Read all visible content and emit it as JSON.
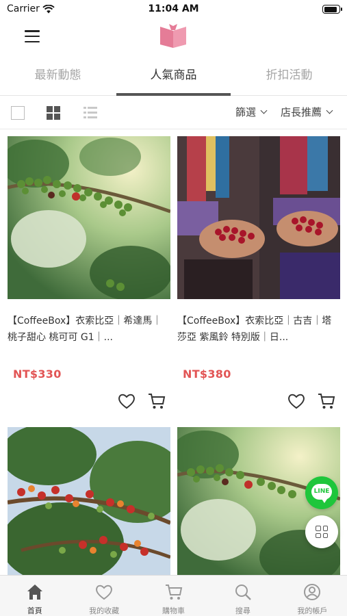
{
  "status_bar": {
    "carrier": "Carrier",
    "time": "11:04 AM"
  },
  "header": {
    "menu_icon": "hamburger-icon",
    "logo_icon": "open-book-logo"
  },
  "tabs": [
    {
      "label": "最新動態",
      "active": false
    },
    {
      "label": "人氣商品",
      "active": true
    },
    {
      "label": "折扣活動",
      "active": false
    }
  ],
  "toolbar": {
    "view_modes": [
      "single-view-icon",
      "grid-view-icon",
      "list-view-icon"
    ],
    "active_view": "grid",
    "filter_label": "篩選",
    "sort_label": "店長推薦"
  },
  "products": [
    {
      "title": "【CoffeeBox】衣索比亞｜希達馬｜桃子甜心 桃可可 G1｜...",
      "price": "NT$330",
      "image": "coffee-cherries-on-branch"
    },
    {
      "title": "【CoffeeBox】衣索比亞｜古吉｜塔莎亞 紫風鈴 特別版｜日...",
      "price": "NT$380",
      "image": "hands-holding-coffee-cherries"
    },
    {
      "title": "",
      "price": "",
      "image": "coffee-tree-ripe-cherries"
    },
    {
      "title": "",
      "price": "",
      "image": "coffee-cherries-on-branch"
    }
  ],
  "floating_buttons": {
    "line_label": "LINE",
    "menu_icon": "apps-grid-icon"
  },
  "bottom_nav": [
    {
      "label": "首頁",
      "icon": "home-icon",
      "active": true
    },
    {
      "label": "我的收藏",
      "icon": "heart-icon",
      "active": false
    },
    {
      "label": "購物車",
      "icon": "cart-icon",
      "active": false
    },
    {
      "label": "搜尋",
      "icon": "search-icon",
      "active": false
    },
    {
      "label": "我的帳戶",
      "icon": "account-icon",
      "active": false
    }
  ],
  "colors": {
    "price": "#e25555",
    "line_green": "#1ec63b",
    "logo_pink": "#e57c97"
  }
}
